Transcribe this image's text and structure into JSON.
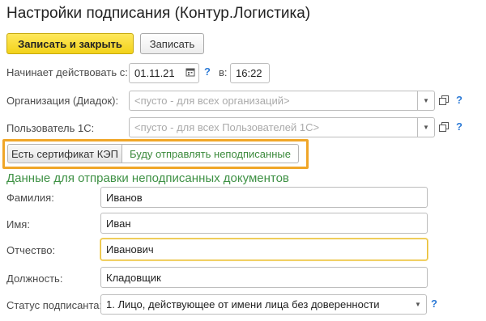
{
  "window": {
    "title": "Настройки подписания (Контур.Логистика)"
  },
  "toolbar": {
    "save_close_label": "Записать и закрыть",
    "save_label": "Записать"
  },
  "start": {
    "label": "Начинает действовать с:",
    "date": "01.11.21",
    "help": "?",
    "time_label": "в:",
    "time": "16:22"
  },
  "org": {
    "label": "Организация (Диадок):",
    "placeholder": "<пусто - для всех организаций>",
    "help": "?"
  },
  "user": {
    "label": "Пользователь 1С:",
    "placeholder": "<пусто - для всех Пользователей 1С>",
    "help": "?"
  },
  "mode": {
    "option_cert": "Есть сертификат КЭП",
    "option_unsigned": "Буду отправлять неподписанные",
    "selected": "Буду отправлять неподписанные"
  },
  "section_title": "Данные для отправки неподписанных документов",
  "person": {
    "surname_label": "Фамилия:",
    "surname": "Иванов",
    "name_label": "Имя:",
    "name": "Иван",
    "patronymic_label": "Отчество:",
    "patronymic": "Иванович",
    "position_label": "Должность:",
    "position": "Кладовщик"
  },
  "status": {
    "label": "Статус подписанта:",
    "value": "1. Лицо, действующее от имени лица без доверенности",
    "help": "?"
  },
  "colors": {
    "accent_yellow": "#f2d21a",
    "highlight_orange": "#f0a628",
    "section_green": "#3e9144",
    "help_blue": "#2e7bd6"
  }
}
